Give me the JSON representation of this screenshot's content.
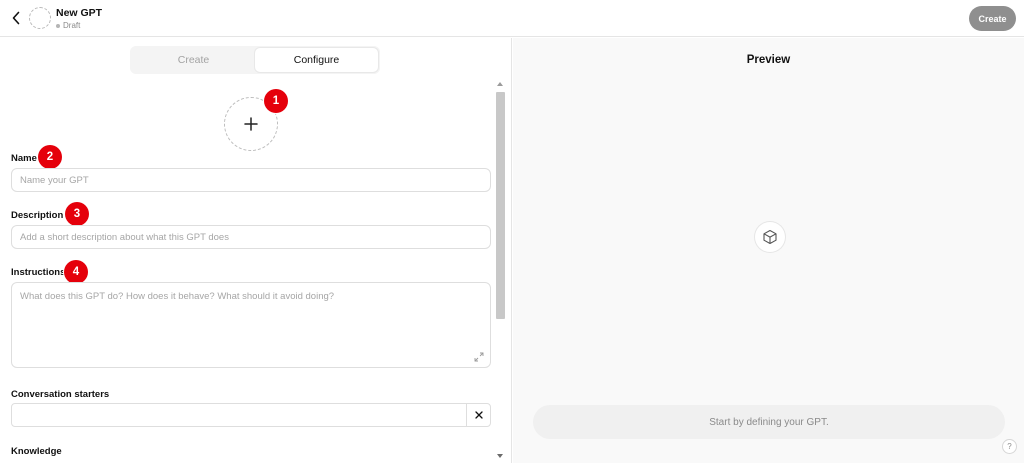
{
  "header": {
    "title": "New GPT",
    "status": "Draft",
    "create_button": "Create",
    "back_icon": "chevron-left-icon"
  },
  "tabs": [
    {
      "label": "Create",
      "active": false
    },
    {
      "label": "Configure",
      "active": true
    }
  ],
  "form": {
    "avatar_upload_icon": "plus-icon",
    "name": {
      "label": "Name",
      "value": "",
      "placeholder": "Name your GPT"
    },
    "description": {
      "label": "Description",
      "value": "",
      "placeholder": "Add a short description about what this GPT does"
    },
    "instructions": {
      "label": "Instructions",
      "value": "",
      "placeholder": "What does this GPT do? How does it behave? What should it avoid doing?"
    },
    "conversation_starters": {
      "label": "Conversation starters",
      "value": "",
      "clear_icon": "close-icon"
    },
    "knowledge": {
      "label": "Knowledge"
    }
  },
  "annotations": [
    "1",
    "2",
    "3",
    "4"
  ],
  "preview": {
    "title": "Preview",
    "icon": "cube-icon",
    "empty_prompt": "Start by defining your GPT.",
    "help": "?"
  },
  "colors": {
    "badge": "#e5000b",
    "create_button_bg": "#8f8f8f",
    "preview_bg": "#f9f9f9"
  }
}
